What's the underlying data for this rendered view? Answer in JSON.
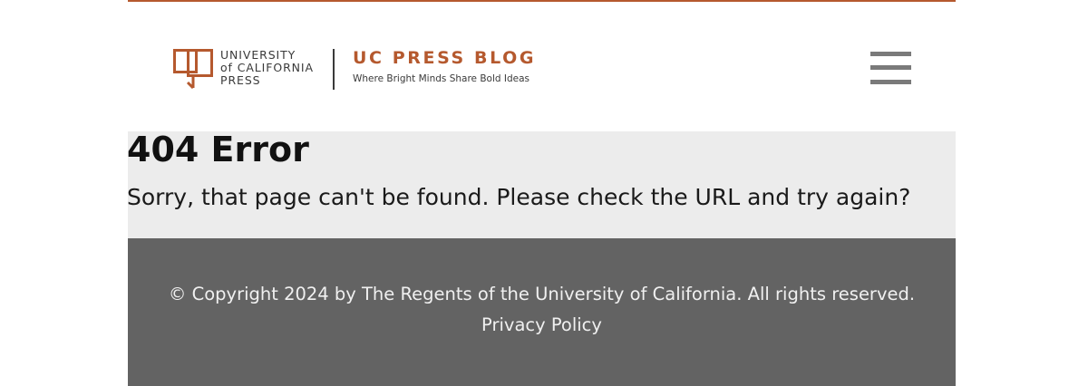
{
  "colors": {
    "brand_accent": "#b5592e",
    "error_band": "#ececec",
    "footer_background": "#636363",
    "menu_icon": "#7a7a7a"
  },
  "header": {
    "logo": {
      "icon": "uc-press-logo-icon",
      "line1": "UNIVERSITY",
      "line2": "of CALIFORNIA",
      "line3": "PRESS"
    },
    "blog_title": "UC PRESS BLOG",
    "tagline": "Where Bright Minds Share Bold Ideas",
    "menu_icon": "hamburger-menu-icon"
  },
  "main": {
    "error_title": "404 Error",
    "error_message": "Sorry, that page can't be found. Please check the URL and try again?"
  },
  "footer": {
    "copyright": "© Copyright 2024 by The Regents of the University of California. All rights reserved.",
    "privacy_link": "Privacy Policy"
  }
}
